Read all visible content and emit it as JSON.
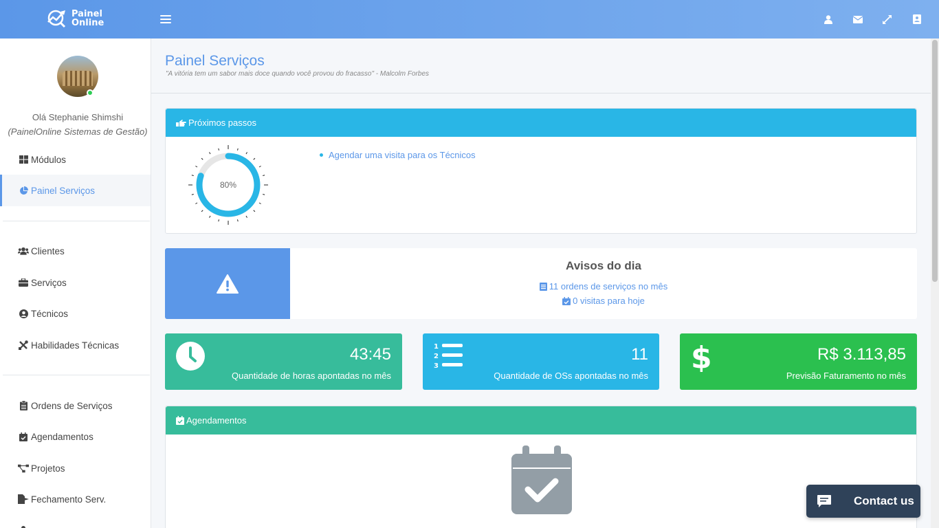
{
  "app": {
    "logo_line1": "Painel",
    "logo_line2": "Online"
  },
  "topbar": {
    "icons": [
      "user-icon",
      "envelope-icon",
      "expand-icon",
      "address-book-icon"
    ]
  },
  "user": {
    "greeting": "Olá Stephanie Shimshi",
    "company": "(PainelOnline Sistemas de Gestão)",
    "status": "online"
  },
  "sidebar": {
    "items": [
      {
        "label": "Módulos",
        "icon": "th-large-icon"
      },
      {
        "label": "Painel Serviços",
        "icon": "pie-chart-icon",
        "active": true
      },
      {
        "label": "Clientes",
        "icon": "users-icon"
      },
      {
        "label": "Serviços",
        "icon": "briefcase-icon"
      },
      {
        "label": "Técnicos",
        "icon": "user-circle-icon"
      },
      {
        "label": "Habilidades Técnicas",
        "icon": "tools-icon"
      },
      {
        "label": "Ordens de Serviços",
        "icon": "clipboard-icon"
      },
      {
        "label": "Agendamentos",
        "icon": "calendar-check-icon"
      },
      {
        "label": "Projetos",
        "icon": "project-diagram-icon"
      },
      {
        "label": "Fechamento Serv.",
        "icon": "file-export-icon"
      }
    ]
  },
  "page": {
    "title": "Painel Serviços",
    "quote": "\"A vitória tem um sabor mais doce quando você provou do fracasso\" - Malcolm Forbes"
  },
  "next_steps": {
    "header": "Próximos passos",
    "progress_percent": 80,
    "progress_label": "80%",
    "steps": [
      "Agendar uma visita para os Técnicos"
    ]
  },
  "notices": {
    "title": "Avisos do dia",
    "line1": "11 ordens de serviços no mês",
    "line2": "0 visitas para hoje"
  },
  "stats": [
    {
      "value": "43:45",
      "label": "Quantidade de horas apontadas no mês",
      "color": "#37bc9b",
      "icon": "clock-icon"
    },
    {
      "value": "11",
      "label": "Quantidade de OSs apontadas no mês",
      "color": "#29b6e6",
      "icon": "list-ol-icon"
    },
    {
      "value": "R$ 3.113,85",
      "label": "Previsão Faturamento no mês",
      "color": "#2bc04f",
      "icon": "dollar-icon"
    }
  ],
  "schedule": {
    "header": "Agendamentos"
  },
  "contact": {
    "label": "Contact us"
  },
  "colors": {
    "primary": "#5b97e8",
    "info": "#29b6e6",
    "success": "#37bc9b",
    "green": "#2bc04f",
    "dark": "#2f4259"
  }
}
